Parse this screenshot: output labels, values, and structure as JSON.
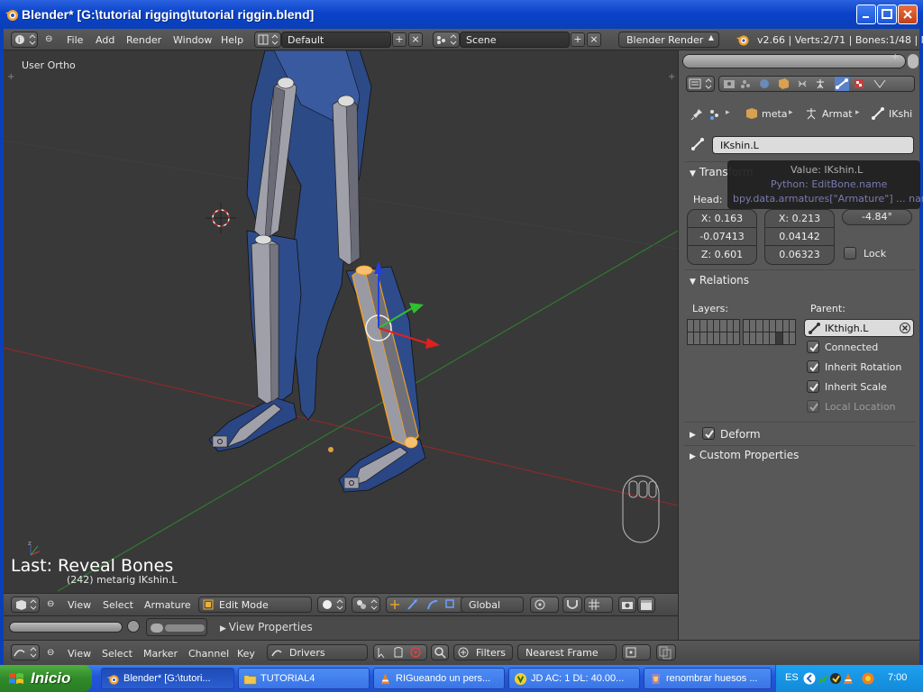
{
  "window": {
    "title": "Blender* [G:\\tutorial rigging\\tutorial riggin.blend]"
  },
  "info_header": {
    "menus": [
      "File",
      "Add",
      "Render",
      "Window",
      "Help"
    ],
    "screen_layout": "Default",
    "scene": "Scene",
    "render_engine": "Blender Render",
    "stats": "v2.66 | Verts:2/71 | Bones:1/48 | Me"
  },
  "viewport": {
    "view_label": "User Ortho",
    "last_operator": "Last: Reveal Bones",
    "object_info": "(242) metarig IKshin.L"
  },
  "viewport_header": {
    "menus": [
      "View",
      "Select",
      "Armature"
    ],
    "mode": "Edit Mode",
    "orientation": "Global"
  },
  "timeline": {
    "view_properties": "View Properties"
  },
  "drivers_header": {
    "menus": [
      "View",
      "Select",
      "Marker",
      "Channel",
      "Key"
    ],
    "mode": "Drivers",
    "filters": "Filters",
    "snap": "Nearest Frame"
  },
  "properties": {
    "breadcrumb": [
      "meta",
      "Armat",
      "IKshi"
    ],
    "bone_name": "IKshin.L",
    "transform_header": "Transform",
    "head_label": "Head:",
    "head": [
      "X: 0.163",
      "-0.07413",
      "Z: 0.601"
    ],
    "tail": [
      "X: 0.213",
      "0.04142",
      "0.06323"
    ],
    "roll": "-4.84°",
    "lock_label": "Lock",
    "relations_header": "Relations",
    "layers_label": "Layers:",
    "parent_label": "Parent:",
    "parent_value": "IKthigh.L",
    "connected": "Connected",
    "inherit_rotation": "Inherit Rotation",
    "inherit_scale": "Inherit Scale",
    "local_location": "Local Location",
    "deform_header": "Deform",
    "custom_props_header": "Custom Properties"
  },
  "tooltip": {
    "value": "Value: IKshin.L",
    "python": "Python: EditBone.name",
    "path": "bpy.data.armatures[\"Armature\"] ... name"
  },
  "taskbar": {
    "start": "Inicio",
    "items": [
      "Blender* [G:\\tutori...",
      "TUTORIAL4",
      "RIGueando un pers...",
      "JD AC: 1 DL: 40.00...",
      "renombrar huesos ..."
    ],
    "lang": "ES",
    "clock": "7:00"
  },
  "colors": {
    "xp_blue": "#0a43c9",
    "blender_bg": "#393939",
    "bone_selected": "#f0a020",
    "mesh_blue": "#2a4a8a"
  }
}
